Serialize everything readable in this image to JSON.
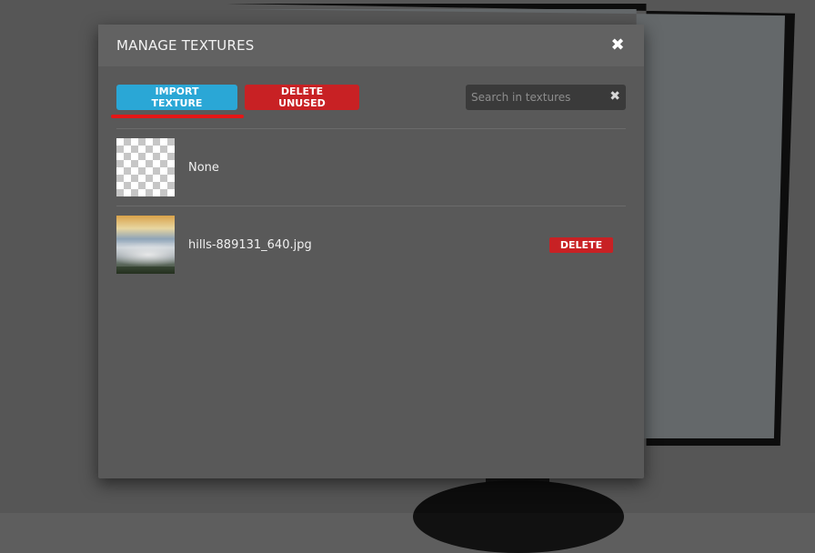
{
  "dialog": {
    "title": "MANAGE TEXTURES",
    "close_icon": "close-icon"
  },
  "toolbar": {
    "import_label": "IMPORT TEXTURE",
    "delete_unused_label": "DELETE UNUSED",
    "search_placeholder": "Search in textures",
    "search_value": ""
  },
  "textures": [
    {
      "name": "None",
      "thumbnail": "transparent-checker",
      "deletable": false
    },
    {
      "name": "hills-889131_640.jpg",
      "thumbnail": "photo-hills",
      "deletable": true,
      "delete_label": "DELETE"
    }
  ],
  "colors": {
    "import": "#2aa7d6",
    "delete": "#c82124",
    "highlight": "#e41616"
  }
}
